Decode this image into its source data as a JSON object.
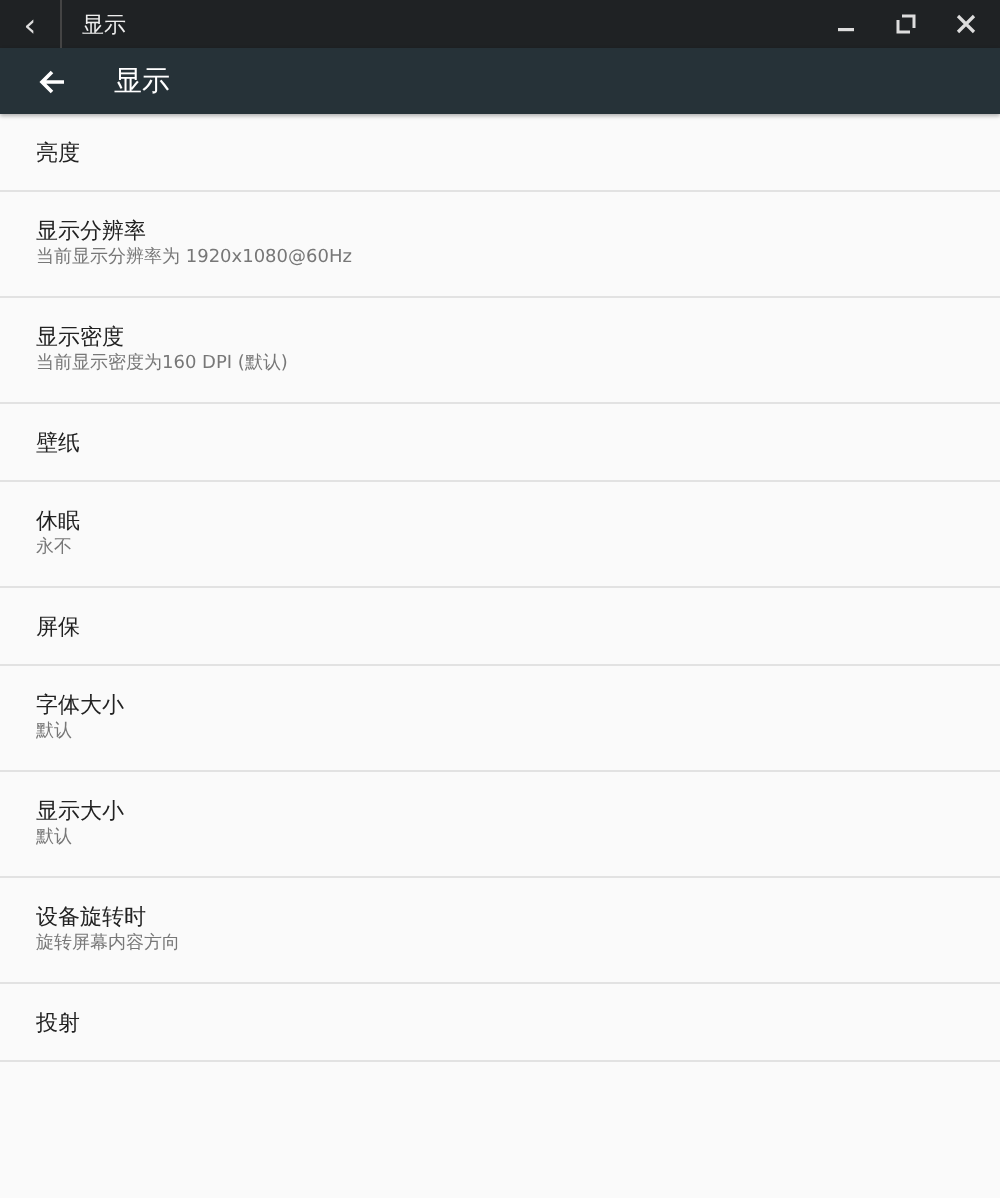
{
  "window": {
    "title": "显示",
    "back": "‹"
  },
  "app_bar": {
    "title": "显示"
  },
  "settings": [
    {
      "title": "亮度"
    },
    {
      "title": "显示分辨率",
      "summary": "当前显示分辨率为 1920x1080@60Hz"
    },
    {
      "title": "显示密度",
      "summary": "当前显示密度为160 DPI (默认)"
    },
    {
      "title": "壁纸"
    },
    {
      "title": "休眠",
      "summary": "永不"
    },
    {
      "title": "屏保"
    },
    {
      "title": "字体大小",
      "summary": "默认"
    },
    {
      "title": "显示大小",
      "summary": "默认"
    },
    {
      "title": "设备旋转时",
      "summary": "旋转屏幕内容方向"
    },
    {
      "title": "投射"
    }
  ]
}
